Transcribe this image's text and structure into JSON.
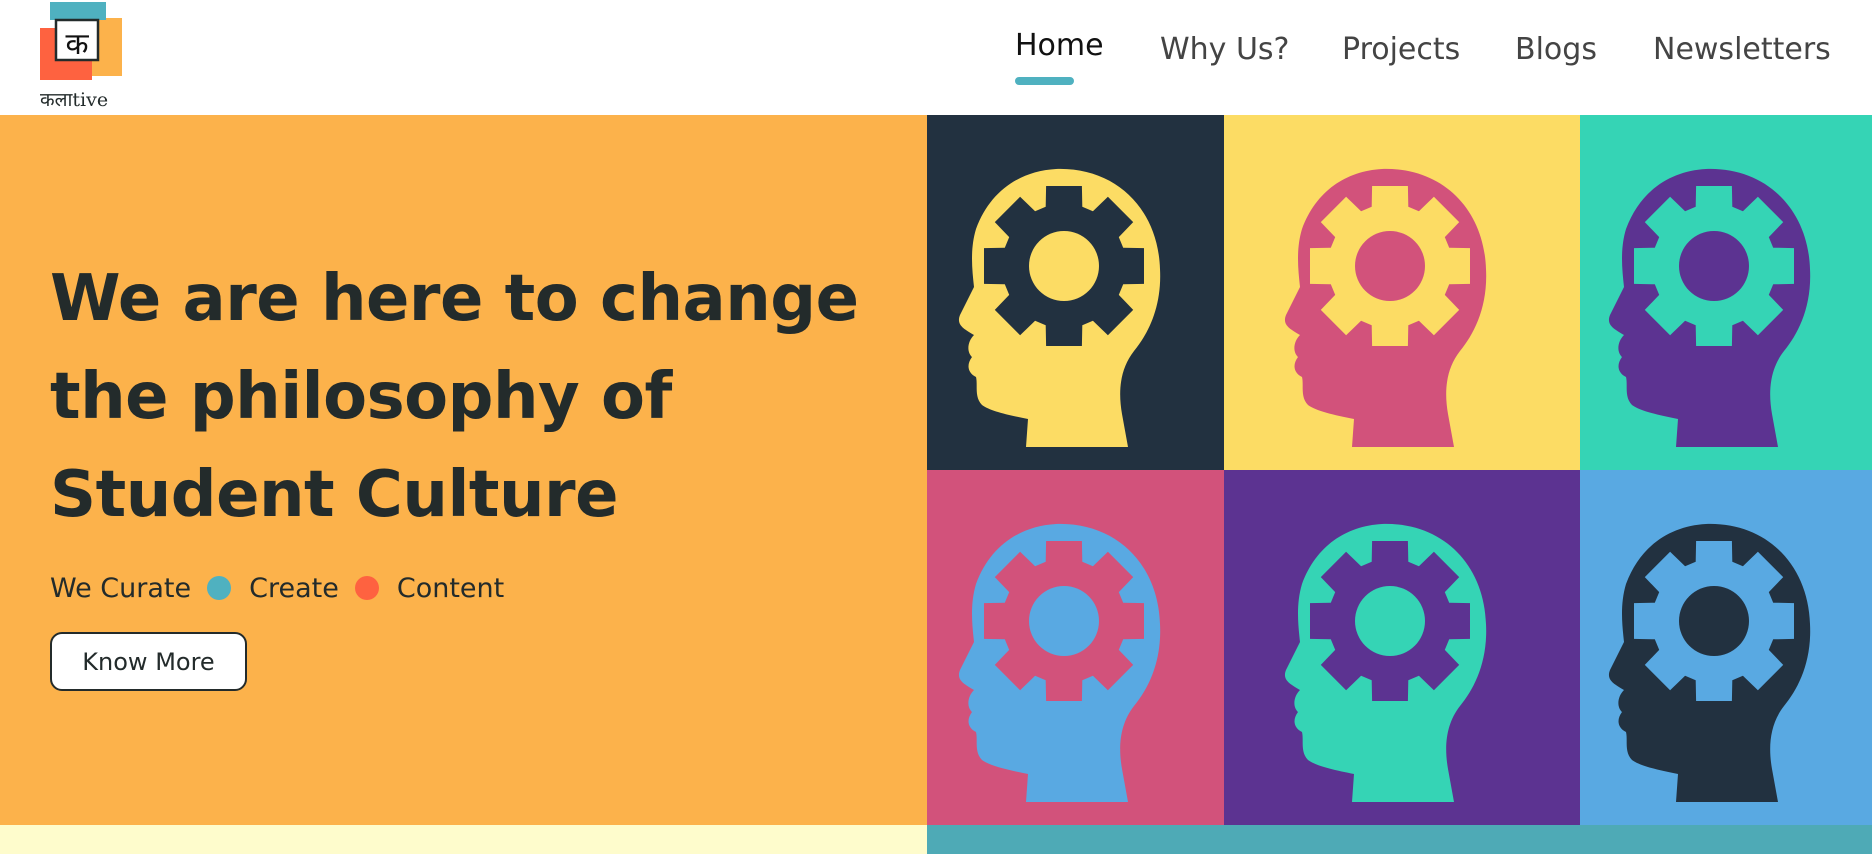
{
  "brand": {
    "logo_glyph": "क",
    "logo_text": "कलाtive"
  },
  "nav": {
    "items": [
      {
        "label": "Home",
        "active": true
      },
      {
        "label": "Why Us?"
      },
      {
        "label": "Projects"
      },
      {
        "label": "Blogs"
      },
      {
        "label": "Newsletters"
      }
    ]
  },
  "hero": {
    "headline_lines": [
      "We are here to change",
      "the philosophy of",
      "Student Culture"
    ],
    "tagline": {
      "part1": "We Curate",
      "part2": "Create",
      "part3": "Content"
    },
    "button_label": "Know More"
  },
  "grid": {
    "tiles": [
      {
        "icon": "head-gear-icon",
        "bg": "#223140",
        "head": "#fcdc64",
        "gear": "#223140"
      },
      {
        "icon": "head-gear-icon",
        "bg": "#fcdc64",
        "head": "#d2527b",
        "gear": "#fcdc64"
      },
      {
        "icon": "head-gear-icon",
        "bg": "#35d4b5",
        "head": "#5c3391",
        "gear": "#35d4b5"
      },
      {
        "icon": "head-gear-icon",
        "bg": "#d2527b",
        "head": "#59a9e2",
        "gear": "#d2527b"
      },
      {
        "icon": "head-gear-icon",
        "bg": "#5c3391",
        "head": "#35d4b5",
        "gear": "#5c3391"
      },
      {
        "icon": "head-gear-icon",
        "bg": "#59a9e2",
        "head": "#223140",
        "gear": "#59a9e2"
      }
    ]
  },
  "colors": {
    "hero_bg": "#fcb24b",
    "accent_teal": "#4fb1c0",
    "accent_orange": "#fe6240",
    "text_dark": "#232b2b",
    "bottom_left": "#fefccc",
    "bottom_right": "#4eaab6"
  }
}
